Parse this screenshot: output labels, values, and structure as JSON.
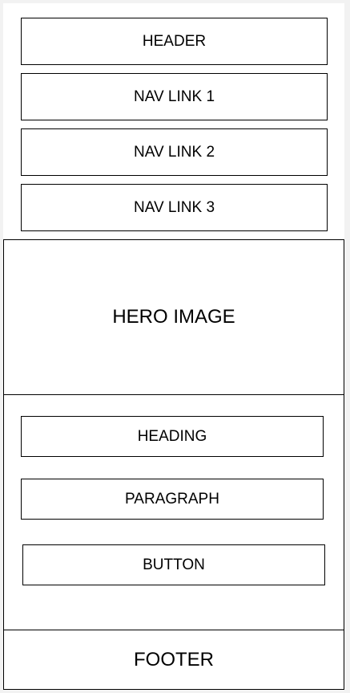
{
  "header": {
    "label": "HEADER"
  },
  "nav": {
    "links": [
      {
        "label": "NAV LINK 1"
      },
      {
        "label": "NAV LINK 2"
      },
      {
        "label": "NAV LINK 3"
      }
    ]
  },
  "hero": {
    "label": "HERO IMAGE"
  },
  "content": {
    "heading": "HEADING",
    "paragraph": "PARAGRAPH",
    "button": "BUTTON"
  },
  "footer": {
    "label": "FOOTER"
  }
}
